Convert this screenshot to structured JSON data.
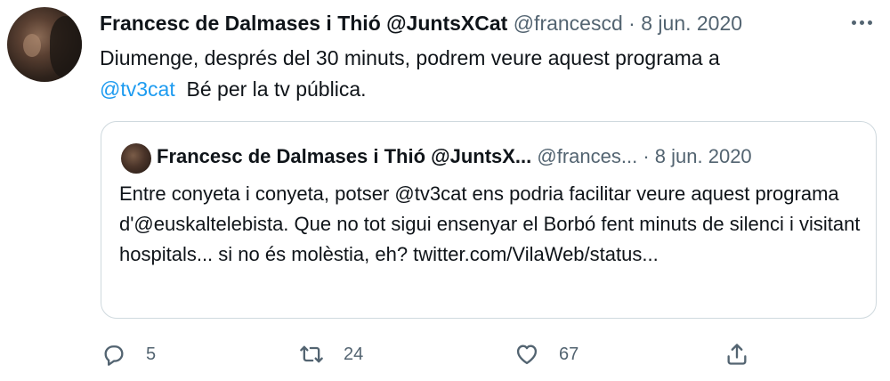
{
  "tweet": {
    "author_name": "Francesc de Dalmases i Thió @JuntsXCat",
    "handle": "@francescd",
    "separator": "·",
    "date": "8 jun. 2020",
    "text_part1": "Diumenge, després del 30 minuts, podrem veure aquest programa a",
    "mention": "@tv3cat",
    "text_part2": "  Bé per la tv pública."
  },
  "quoted_tweet": {
    "author_name": "Francesc de Dalmases i Thió @JuntsX...",
    "handle": "@frances...",
    "separator": "·",
    "date": "8 jun. 2020",
    "text": "Entre conyeta i conyeta, potser @tv3cat ens podria facilitar veure aquest programa d'@euskaltelebista. Que no tot sigui ensenyar el Borbó fent minuts de silenci i visitant hospitals... si no és molèstia, eh? twitter.com/VilaWeb/status..."
  },
  "actions": {
    "reply_count": "5",
    "retweet_count": "24",
    "like_count": "67"
  },
  "icons": {
    "more": "more-options-icon",
    "reply": "reply-icon",
    "retweet": "retweet-icon",
    "like": "heart-icon",
    "share": "share-icon"
  },
  "colors": {
    "text": "#0f1419",
    "secondary": "#536471",
    "link": "#1d9bf0",
    "border": "#cfd9de"
  }
}
